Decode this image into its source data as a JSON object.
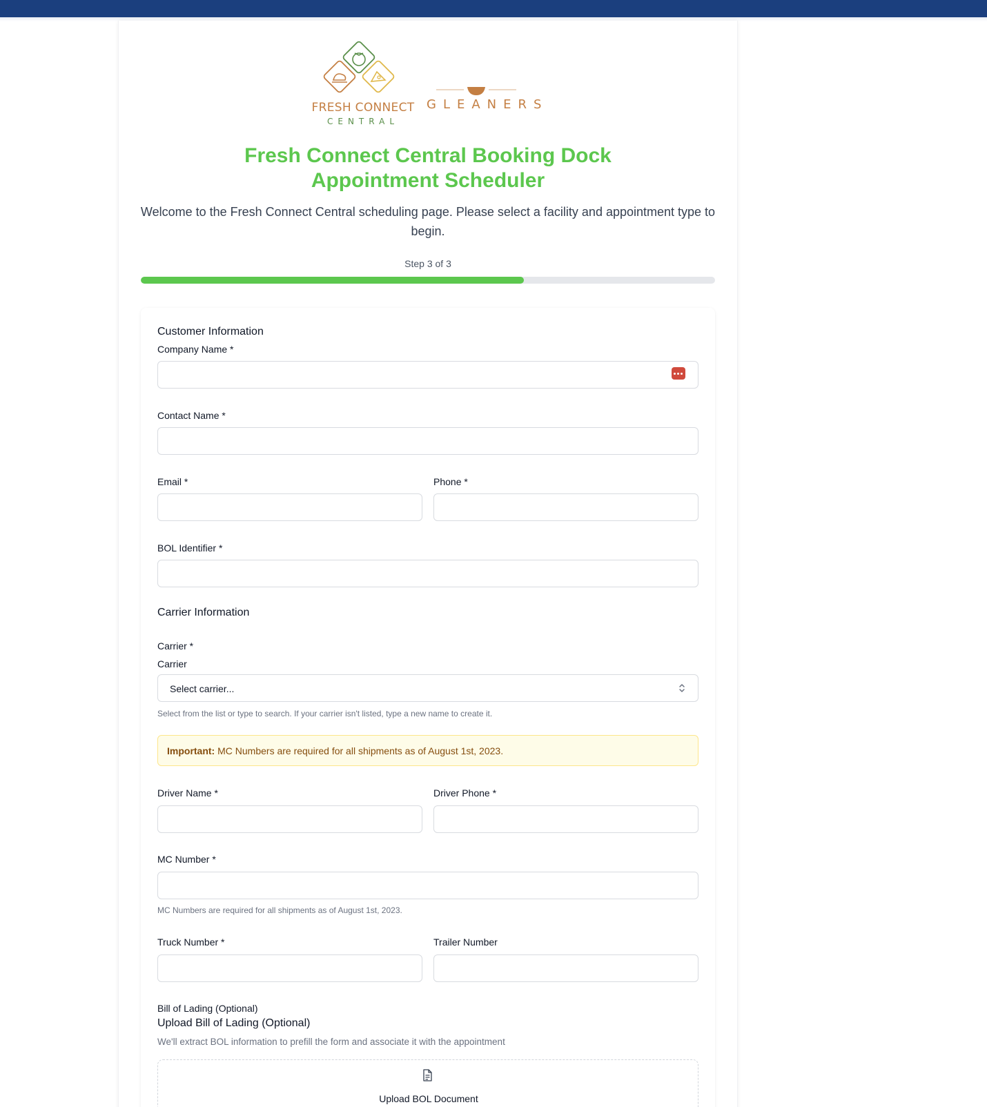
{
  "colors": {
    "topbar": "#1b3f7e",
    "accent_green": "#5cc74e",
    "logo_orange": "#c47f43",
    "logo_green": "#5a8f4a",
    "alert_bg": "#fefce8",
    "alert_text": "#854d0e"
  },
  "logo": {
    "fcc_text": "FRESH CONNECT",
    "central_text": "CENTRAL",
    "gleaners_text": "GLEANERS"
  },
  "header": {
    "title": "Fresh Connect Central Booking Dock Appointment Scheduler",
    "subtitle": "Welcome to the Fresh Connect Central scheduling page. Please select a facility and appointment type to begin.",
    "step_text": "Step 3 of 3",
    "progress_fraction": 0.667
  },
  "customer": {
    "section_title": "Customer Information",
    "company_label": "Company Name *",
    "contact_label": "Contact Name *",
    "email_label": "Email *",
    "phone_label": "Phone *",
    "bol_label": "BOL Identifier *"
  },
  "carrier": {
    "section_title": "Carrier Information",
    "carrier_required_label": "Carrier *",
    "carrier_label": "Carrier",
    "select_value": "Select carrier...",
    "select_help": "Select from the list or type to search. If your carrier isn't listed, type a new name to create it.",
    "alert_strong": "Important:",
    "alert_text": " MC Numbers are required for all shipments as of August 1st, 2023.",
    "driver_name_label": "Driver Name *",
    "driver_phone_label": "Driver Phone *",
    "mc_label": "MC Number *",
    "mc_help": "MC Numbers are required for all shipments as of August 1st, 2023.",
    "truck_label": "Truck Number *",
    "trailer_label": "Trailer Number"
  },
  "bol": {
    "section_label": "Bill of Lading (Optional)",
    "upload_title": "Upload Bill of Lading (Optional)",
    "upload_help": "We'll extract BOL information to prefill the form and associate it with the appointment",
    "upload_button": "Upload BOL Document"
  }
}
